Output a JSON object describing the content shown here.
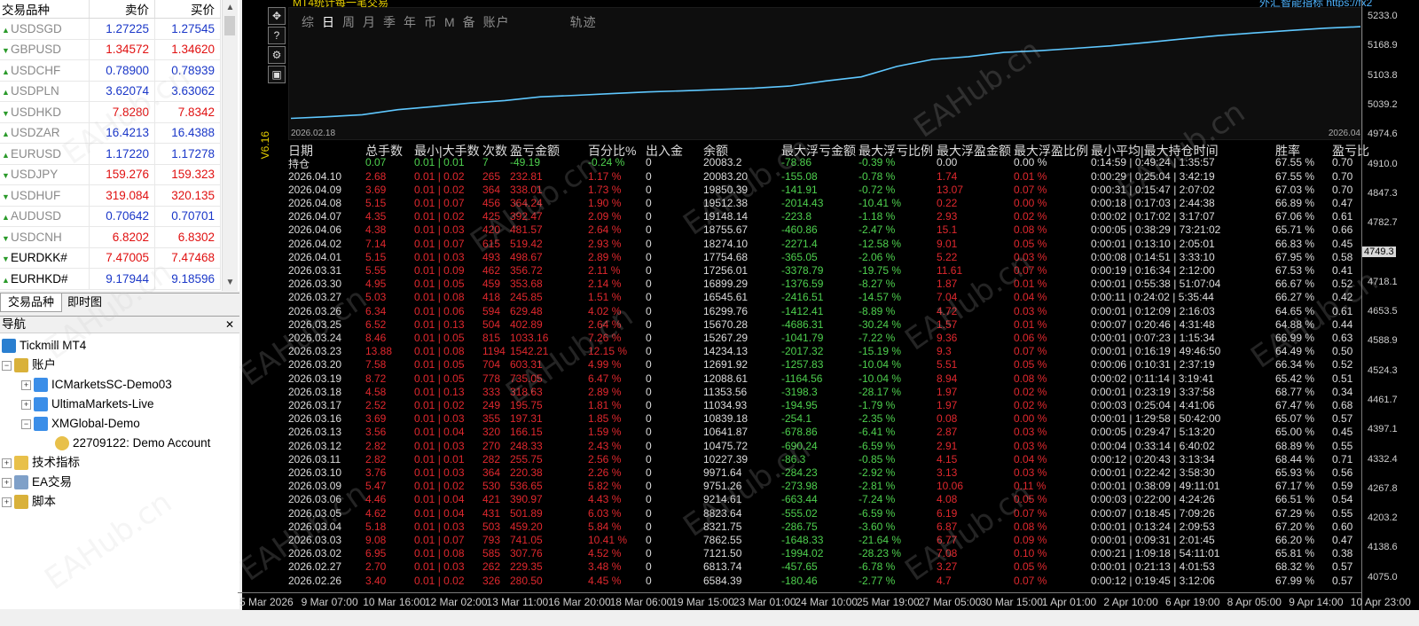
{
  "market_watch": {
    "header_symbol": "交易品种",
    "header_bid": "卖价",
    "header_ask": "买价",
    "rows": [
      {
        "symbol": "USDSGD",
        "bid": "1.27225",
        "ask": "1.27545",
        "dir": "up",
        "dark": false
      },
      {
        "symbol": "GBPUSD",
        "bid": "1.34572",
        "ask": "1.34620",
        "dir": "dn",
        "dark": false
      },
      {
        "symbol": "USDCHF",
        "bid": "0.78900",
        "ask": "0.78939",
        "dir": "up",
        "dark": false
      },
      {
        "symbol": "USDPLN",
        "bid": "3.62074",
        "ask": "3.63062",
        "dir": "up",
        "dark": false
      },
      {
        "symbol": "USDHKD",
        "bid": "7.8280",
        "ask": "7.8342",
        "dir": "dn",
        "dark": false
      },
      {
        "symbol": "USDZAR",
        "bid": "16.4213",
        "ask": "16.4388",
        "dir": "up",
        "dark": false
      },
      {
        "symbol": "EURUSD",
        "bid": "1.17220",
        "ask": "1.17278",
        "dir": "up",
        "dark": false
      },
      {
        "symbol": "USDJPY",
        "bid": "159.276",
        "ask": "159.323",
        "dir": "dn",
        "dark": false
      },
      {
        "symbol": "USDHUF",
        "bid": "319.084",
        "ask": "320.135",
        "dir": "dn",
        "dark": false
      },
      {
        "symbol": "AUDUSD",
        "bid": "0.70642",
        "ask": "0.70701",
        "dir": "up",
        "dark": false
      },
      {
        "symbol": "USDCNH",
        "bid": "6.8202",
        "ask": "6.8302",
        "dir": "dn",
        "dark": false
      },
      {
        "symbol": "EURDKK#",
        "bid": "7.47005",
        "ask": "7.47468",
        "dir": "dn",
        "dark": true
      },
      {
        "symbol": "EURHKD#",
        "bid": "9.17944",
        "ask": "9.18596",
        "dir": "up",
        "dark": true
      }
    ]
  },
  "tabs": {
    "symbols": "交易品种",
    "tick": "即时图"
  },
  "navigator": {
    "title": "导航",
    "root": "Tickmill MT4",
    "accounts": "账户",
    "acc1": "ICMarketsSC-Demo03",
    "acc2": "UltimaMarkets-Live",
    "acc3": "XMGlobal-Demo",
    "acc3_sub": "22709122: Demo Account",
    "indicators": "技术指标",
    "ea": "EA交易",
    "scripts": "脚本"
  },
  "panel": {
    "title": "MT4统计每一笔交易",
    "title_right": "外汇智能指标 https://fx2",
    "menu": [
      "综",
      "日",
      "周",
      "月",
      "季",
      "年",
      "币",
      "M",
      "备",
      "账户",
      "轨迹"
    ],
    "selected": "日",
    "date_left": "2026.02.18",
    "date_right": "2026.04",
    "version": "V6.16"
  },
  "table": {
    "headers": [
      "日期",
      "总手数",
      "最小|大手数",
      "次数",
      "盈亏金额",
      "百分比%",
      "出入金",
      "余额",
      "最大浮亏金额",
      "最大浮亏比例",
      "最大浮盈金额",
      "最大浮盈比例",
      "最小平均|最大持仓时间",
      "胜率",
      "盈亏比"
    ],
    "position_row": {
      "date": "持仓",
      "lots": "0.07",
      "minmax": "0.01 | 0.01",
      "count": "7",
      "pnl": "-49.19",
      "pct": "-0.24 %",
      "dep": "0",
      "bal": "20083.2",
      "mfl": "-78.86",
      "mflp": "-0.39 %",
      "mfp": "0.00",
      "mfpp": "0.00 %",
      "time": "0:14:59 | 0:49:24 | 1:35:57",
      "win": "67.55 %",
      "pf": "0.70"
    },
    "rows": [
      [
        "2026.04.10",
        "2.68",
        "0.01 | 0.02",
        "265",
        "232.81",
        "1.17 %",
        "0",
        "20083.20",
        "-155.08",
        "-0.78 %",
        "1.74",
        "0.01 %",
        "0:00:29 | 0:25:04 | 3:42:19",
        "67.55 %",
        "0.70"
      ],
      [
        "2026.04.09",
        "3.69",
        "0.01 | 0.02",
        "364",
        "338.01",
        "1.73 %",
        "0",
        "19850.39",
        "-141.91",
        "-0.72 %",
        "13.07",
        "0.07 %",
        "0:00:31 | 0:15:47 | 2:07:02",
        "67.03 %",
        "0.70"
      ],
      [
        "2026.04.08",
        "5.15",
        "0.01 | 0.07",
        "456",
        "364.24",
        "1.90 %",
        "0",
        "19512.38",
        "-2014.43",
        "-10.41 %",
        "0.22",
        "0.00 %",
        "0:00:18 | 0:17:03 | 2:44:38",
        "66.89 %",
        "0.47"
      ],
      [
        "2026.04.07",
        "4.35",
        "0.01 | 0.02",
        "425",
        "392.47",
        "2.09 %",
        "0",
        "19148.14",
        "-223.8",
        "-1.18 %",
        "2.93",
        "0.02 %",
        "0:00:02 | 0:17:02 | 3:17:07",
        "67.06 %",
        "0.61"
      ],
      [
        "2026.04.06",
        "4.38",
        "0.01 | 0.03",
        "420",
        "481.57",
        "2.64 %",
        "0",
        "18755.67",
        "-460.86",
        "-2.47 %",
        "15.1",
        "0.08 %",
        "0:00:05 | 0:38:29 | 73:21:02",
        "65.71 %",
        "0.66"
      ],
      [
        "2026.04.02",
        "7.14",
        "0.01 | 0.07",
        "615",
        "519.42",
        "2.93 %",
        "0",
        "18274.10",
        "-2271.4",
        "-12.58 %",
        "9.01",
        "0.05 %",
        "0:00:01 | 0:13:10 | 2:05:01",
        "66.83 %",
        "0.45"
      ],
      [
        "2026.04.01",
        "5.15",
        "0.01 | 0.03",
        "493",
        "498.67",
        "2.89 %",
        "0",
        "17754.68",
        "-365.05",
        "-2.06 %",
        "5.22",
        "0.03 %",
        "0:00:08 | 0:14:51 | 3:33:10",
        "67.95 %",
        "0.58"
      ],
      [
        "2026.03.31",
        "5.55",
        "0.01 | 0.09",
        "462",
        "356.72",
        "2.11 %",
        "0",
        "17256.01",
        "-3378.79",
        "-19.75 %",
        "11.61",
        "0.07 %",
        "0:00:19 | 0:16:34 | 2:12:00",
        "67.53 %",
        "0.41"
      ],
      [
        "2026.03.30",
        "4.95",
        "0.01 | 0.05",
        "459",
        "353.68",
        "2.14 %",
        "0",
        "16899.29",
        "-1376.59",
        "-8.27 %",
        "1.87",
        "0.01 %",
        "0:00:01 | 0:55:38 | 51:07:04",
        "66.67 %",
        "0.52"
      ],
      [
        "2026.03.27",
        "5.03",
        "0.01 | 0.08",
        "418",
        "245.85",
        "1.51 %",
        "0",
        "16545.61",
        "-2416.51",
        "-14.57 %",
        "7.04",
        "0.04 %",
        "0:00:11 | 0:24:02 | 5:35:44",
        "66.27 %",
        "0.42"
      ],
      [
        "2026.03.26",
        "6.34",
        "0.01 | 0.06",
        "594",
        "629.48",
        "4.02 %",
        "0",
        "16299.76",
        "-1412.41",
        "-8.89 %",
        "4.72",
        "0.03 %",
        "0:00:01 | 0:12:09 | 2:16:03",
        "64.65 %",
        "0.61"
      ],
      [
        "2026.03.25",
        "6.52",
        "0.01 | 0.13",
        "504",
        "402.89",
        "2.64 %",
        "0",
        "15670.28",
        "-4686.31",
        "-30.24 %",
        "1.57",
        "0.01 %",
        "0:00:07 | 0:20:46 | 4:31:48",
        "64.88 %",
        "0.44"
      ],
      [
        "2026.03.24",
        "8.46",
        "0.01 | 0.05",
        "815",
        "1033.16",
        "7.26 %",
        "0",
        "15267.29",
        "-1041.79",
        "-7.22 %",
        "9.36",
        "0.06 %",
        "0:00:01 | 0:07:23 | 1:15:34",
        "66.99 %",
        "0.63"
      ],
      [
        "2026.03.23",
        "13.88",
        "0.01 | 0.08",
        "1194",
        "1542.21",
        "12.15 %",
        "0",
        "14234.13",
        "-2017.32",
        "-15.19 %",
        "9.3",
        "0.07 %",
        "0:00:01 | 0:16:19 | 49:46:50",
        "64.49 %",
        "0.50"
      ],
      [
        "2026.03.20",
        "7.58",
        "0.01 | 0.05",
        "704",
        "603.31",
        "4.99 %",
        "0",
        "12691.92",
        "-1257.83",
        "-10.04 %",
        "5.51",
        "0.05 %",
        "0:00:06 | 0:10:31 | 2:37:19",
        "66.34 %",
        "0.52"
      ],
      [
        "2026.03.19",
        "8.72",
        "0.01 | 0.05",
        "778",
        "735.05",
        "6.47 %",
        "0",
        "12088.61",
        "-1164.56",
        "-10.04 %",
        "8.94",
        "0.08 %",
        "0:00:02 | 0:11:14 | 3:19:41",
        "65.42 %",
        "0.51"
      ],
      [
        "2026.03.18",
        "4.58",
        "0.01 | 0.13",
        "333",
        "318.63",
        "2.89 %",
        "0",
        "11353.56",
        "-3198.3",
        "-28.17 %",
        "1.97",
        "0.02 %",
        "0:00:01 | 0:23:19 | 3:37:58",
        "68.77 %",
        "0.34"
      ],
      [
        "2026.03.17",
        "2.52",
        "0.01 | 0.02",
        "249",
        "195.75",
        "1.81 %",
        "0",
        "11034.93",
        "-194.95",
        "-1.79 %",
        "1.97",
        "0.02 %",
        "0:00:03 | 0:25:04 | 4:41:06",
        "67.47 %",
        "0.68"
      ],
      [
        "2026.03.16",
        "3.69",
        "0.01 | 0.03",
        "355",
        "197.31",
        "1.85 %",
        "0",
        "10839.18",
        "-254.1",
        "-2.35 %",
        "0.08",
        "0.00 %",
        "0:00:01 | 1:29:58 | 50:42:00",
        "65.07 %",
        "0.57"
      ],
      [
        "2026.03.13",
        "3.56",
        "0.01 | 0.04",
        "320",
        "166.15",
        "1.59 %",
        "0",
        "10641.87",
        "-678.86",
        "-6.41 %",
        "2.87",
        "0.03 %",
        "0:00:05 | 0:29:47 | 5:13:20",
        "65.00 %",
        "0.45"
      ],
      [
        "2026.03.12",
        "2.82",
        "0.01 | 0.03",
        "270",
        "248.33",
        "2.43 %",
        "0",
        "10475.72",
        "-690.24",
        "-6.59 %",
        "2.91",
        "0.03 %",
        "0:00:04 | 0:33:14 | 6:40:02",
        "68.89 %",
        "0.55"
      ],
      [
        "2026.03.11",
        "2.82",
        "0.01 | 0.01",
        "282",
        "255.75",
        "2.56 %",
        "0",
        "10227.39",
        "-86.3",
        "-0.85 %",
        "4.15",
        "0.04 %",
        "0:00:12 | 0:20:43 | 3:13:34",
        "68.44 %",
        "0.71"
      ],
      [
        "2026.03.10",
        "3.76",
        "0.01 | 0.03",
        "364",
        "220.38",
        "2.26 %",
        "0",
        "9971.64",
        "-284.23",
        "-2.92 %",
        "3.13",
        "0.03 %",
        "0:00:01 | 0:22:42 | 3:58:30",
        "65.93 %",
        "0.56"
      ],
      [
        "2026.03.09",
        "5.47",
        "0.01 | 0.02",
        "530",
        "536.65",
        "5.82 %",
        "0",
        "9751.26",
        "-273.98",
        "-2.81 %",
        "10.06",
        "0.11 %",
        "0:00:01 | 0:38:09 | 49:11:01",
        "67.17 %",
        "0.59"
      ],
      [
        "2026.03.06",
        "4.46",
        "0.01 | 0.04",
        "421",
        "390.97",
        "4.43 %",
        "0",
        "9214.61",
        "-663.44",
        "-7.24 %",
        "4.08",
        "0.05 %",
        "0:00:03 | 0:22:00 | 4:24:26",
        "66.51 %",
        "0.54"
      ],
      [
        "2026.03.05",
        "4.62",
        "0.01 | 0.04",
        "431",
        "501.89",
        "6.03 %",
        "0",
        "8823.64",
        "-555.02",
        "-6.59 %",
        "6.19",
        "0.07 %",
        "0:00:07 | 0:18:45 | 7:09:26",
        "67.29 %",
        "0.55"
      ],
      [
        "2026.03.04",
        "5.18",
        "0.01 | 0.03",
        "503",
        "459.20",
        "5.84 %",
        "0",
        "8321.75",
        "-286.75",
        "-3.60 %",
        "6.87",
        "0.08 %",
        "0:00:01 | 0:13:24 | 2:09:53",
        "67.20 %",
        "0.60"
      ],
      [
        "2026.03.03",
        "9.08",
        "0.01 | 0.07",
        "793",
        "741.05",
        "10.41 %",
        "0",
        "7862.55",
        "-1648.33",
        "-21.64 %",
        "6.77",
        "0.09 %",
        "0:00:01 | 0:09:31 | 2:01:45",
        "66.20 %",
        "0.47"
      ],
      [
        "2026.03.02",
        "6.95",
        "0.01 | 0.08",
        "585",
        "307.76",
        "4.52 %",
        "0",
        "7121.50",
        "-1994.02",
        "-28.23 %",
        "7.08",
        "0.10 %",
        "0:00:21 | 1:09:18 | 54:11:01",
        "65.81 %",
        "0.38"
      ],
      [
        "2026.02.27",
        "2.70",
        "0.01 | 0.03",
        "262",
        "229.35",
        "3.48 %",
        "0",
        "6813.74",
        "-457.65",
        "-6.78 %",
        "3.27",
        "0.05 %",
        "0:00:01 | 0:21:13 | 4:01:53",
        "68.32 %",
        "0.57"
      ],
      [
        "2026.02.26",
        "3.40",
        "0.01 | 0.02",
        "326",
        "280.50",
        "4.45 %",
        "0",
        "6584.39",
        "-180.46",
        "-2.77 %",
        "4.7",
        "0.07 %",
        "0:00:12 | 0:19:45 | 3:12:06",
        "67.99 %",
        "0.57"
      ]
    ]
  },
  "price_axis": [
    "5233.0",
    "5168.9",
    "5103.8",
    "5039.2",
    "4974.6",
    "4910.0",
    "4847.3",
    "4782.7",
    "4749.3",
    "4718.1",
    "4653.5",
    "4588.9",
    "4524.3",
    "4461.7",
    "4397.1",
    "4332.4",
    "4267.8",
    "4203.2",
    "4138.6",
    "4075.0"
  ],
  "time_axis": [
    "5 Mar 2026",
    "9 Mar 07:00",
    "10 Mar 16:00",
    "12 Mar 02:00",
    "13 Mar 11:00",
    "16 Mar 20:00",
    "18 Mar 06:00",
    "19 Mar 15:00",
    "23 Mar 01:00",
    "24 Mar 10:00",
    "25 Mar 19:00",
    "27 Mar 05:00",
    "30 Mar 15:00",
    "1 Apr 01:00",
    "2 Apr 10:00",
    "6 Apr 19:00",
    "8 Apr 05:00",
    "9 Apr 14:00",
    "10 Apr 23:00"
  ],
  "watermark": "EAHub.cn",
  "colors": {
    "equity_line": "#5fc8ff",
    "loss": "#e0282e",
    "gain": "#4ed04e",
    "title": "#e8d000"
  }
}
